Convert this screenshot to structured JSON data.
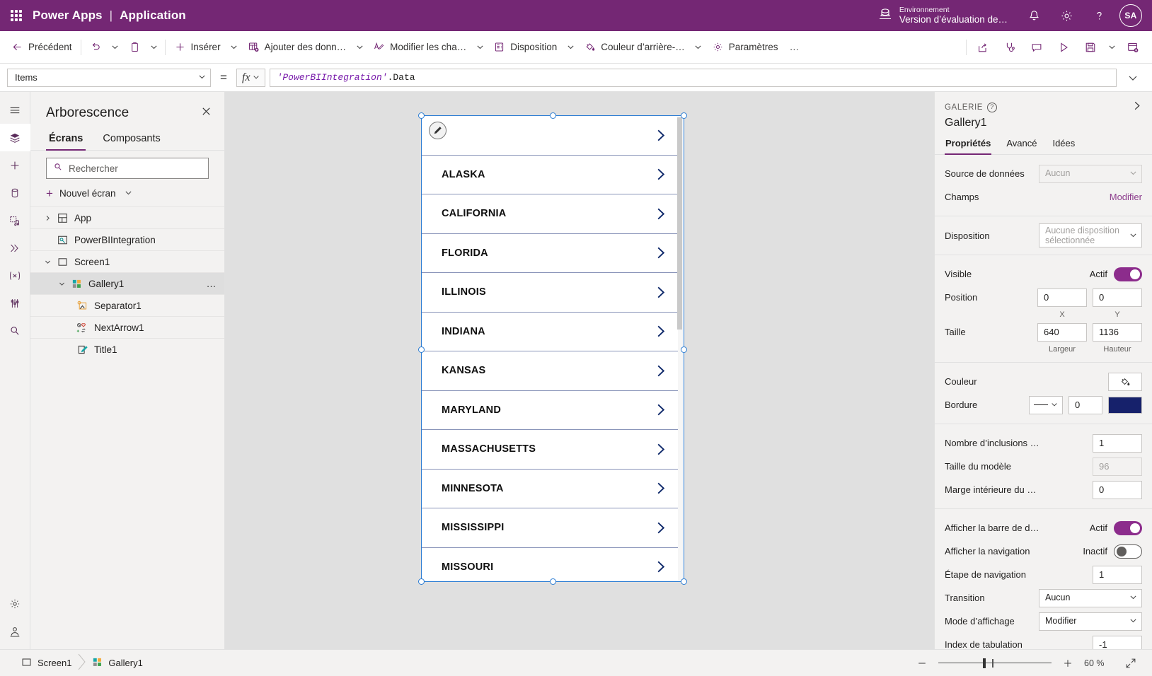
{
  "header": {
    "waffle_icon": "waffle-icon",
    "product": "Power Apps",
    "separator": "|",
    "app_name": "Application",
    "environment_label": "Environnement",
    "environment_value": "Version d’évaluation de…",
    "globe_icon": "environment-globe-icon",
    "bell_icon": "notifications-bell-icon",
    "gear_icon": "settings-gear-icon",
    "help_icon": "help-question-icon",
    "avatar_initials": "SA",
    "brand_color": "#742774"
  },
  "commandbar": {
    "back": "Précédent",
    "undo_icon": "undo-icon",
    "paste_icon": "paste-clipboard-icon",
    "insert": "Insérer",
    "add_data": "Ajouter des donn…",
    "edit_fields": "Modifier les cha…",
    "layout": "Disposition",
    "background_color": "Couleur d’arrière-…",
    "settings": "Paramètres",
    "overflow": "…",
    "right_icons": [
      "share-icon",
      "app-checker-icon",
      "comments-icon",
      "preview-play-icon",
      "save-icon",
      "save-chevron-icon",
      "publish-icon"
    ]
  },
  "formulabar": {
    "property": "Items",
    "equals": "=",
    "fx": "fx",
    "formula_quoted": "'PowerBIIntegration'",
    "formula_rest": ".Data"
  },
  "rail": {
    "items": [
      {
        "name": "hamburger-menu-icon"
      },
      {
        "name": "tree-view-layers-icon",
        "active": true
      },
      {
        "name": "insert-plus-icon"
      },
      {
        "name": "data-cylinder-icon"
      },
      {
        "name": "media-icon"
      },
      {
        "name": "power-automate-icon"
      },
      {
        "name": "variables-icon"
      },
      {
        "name": "tools-icon"
      },
      {
        "name": "search-icon"
      }
    ],
    "bottom": [
      {
        "name": "settings-gear-icon"
      },
      {
        "name": "account-icon"
      }
    ]
  },
  "tree": {
    "title": "Arborescence",
    "close_icon": "close-icon",
    "tabs": [
      {
        "label": "Écrans",
        "active": true
      },
      {
        "label": "Composants",
        "active": false
      }
    ],
    "search_placeholder": "Rechercher",
    "search_value": "",
    "search_icon": "search-icon",
    "new_screen": "Nouvel écran",
    "items": [
      {
        "label": "App",
        "icon": "app-icon",
        "indent": 0,
        "chevron": "collapsed",
        "selected": false
      },
      {
        "label": "PowerBIIntegration",
        "icon": "powerbi-integration-icon",
        "indent": 1,
        "chevron": "none",
        "selected": false
      },
      {
        "label": "Screen1",
        "icon": "screen-icon",
        "indent": 0,
        "chevron": "expanded",
        "selected": false
      },
      {
        "label": "Gallery1",
        "icon": "gallery-icon",
        "indent": 1,
        "chevron": "expanded",
        "selected": true,
        "menu": "…"
      },
      {
        "label": "Separator1",
        "icon": "separator-icon",
        "indent": 2,
        "chevron": "none",
        "selected": false
      },
      {
        "label": "NextArrow1",
        "icon": "next-arrow-icon",
        "indent": 2,
        "chevron": "none",
        "selected": false
      },
      {
        "label": "Title1",
        "icon": "title-label-icon",
        "indent": 2,
        "chevron": "none",
        "selected": false
      }
    ]
  },
  "canvas": {
    "edit_badge_icon": "pencil-edit-icon",
    "gallery_rows": [
      {
        "label": ""
      },
      {
        "label": "ALASKA"
      },
      {
        "label": "CALIFORNIA"
      },
      {
        "label": "FLORIDA"
      },
      {
        "label": "ILLINOIS"
      },
      {
        "label": "INDIANA"
      },
      {
        "label": "KANSAS"
      },
      {
        "label": "MARYLAND"
      },
      {
        "label": "MASSACHUSETTS"
      },
      {
        "label": "MINNESOTA"
      },
      {
        "label": "MISSISSIPPI"
      },
      {
        "label": "MISSOURI"
      }
    ],
    "row_arrow_icon": "chevron-right-icon",
    "selection_color": "#2b7cd3"
  },
  "properties": {
    "kicker": "GALERIE",
    "help_icon": "help-question-icon",
    "collapse_icon": "collapse-panel-icon",
    "control_name": "Gallery1",
    "tabs": [
      {
        "label": "Propriétés",
        "active": true
      },
      {
        "label": "Avancé",
        "active": false
      },
      {
        "label": "Idées",
        "active": false
      }
    ],
    "data_source_label": "Source de données",
    "data_source_value": "Aucun",
    "fields_label": "Champs",
    "fields_action": "Modifier",
    "layout_label": "Disposition",
    "layout_value": "Aucune disposition sélectionnée",
    "visible_label": "Visible",
    "visible_state": "Actif",
    "position_label": "Position",
    "position_x": "0",
    "position_y": "0",
    "position_x_sub": "X",
    "position_y_sub": "Y",
    "size_label": "Taille",
    "size_width": "640",
    "size_height": "1136",
    "size_width_sub": "Largeur",
    "size_height_sub": "Hauteur",
    "color_label": "Couleur",
    "color_icon": "fill-bucket-icon",
    "border_label": "Bordure",
    "border_style_icon": "solid-line-icon",
    "border_width": "0",
    "border_color": "#16216b",
    "wrap_count_label": "Nombre d’inclusions …",
    "wrap_count_value": "1",
    "template_size_label": "Taille du modèle",
    "template_size_value": "96",
    "template_padding_label": "Marge intérieure du …",
    "template_padding_value": "0",
    "show_scrollbar_label": "Afficher la barre de d…",
    "show_scrollbar_state": "Actif",
    "show_navigation_label": "Afficher la navigation",
    "show_navigation_state": "Inactif",
    "nav_step_label": "Étape de navigation",
    "nav_step_value": "1",
    "transition_label": "Transition",
    "transition_value": "Aucun",
    "display_mode_label": "Mode d’affichage",
    "display_mode_value": "Modifier",
    "tab_index_label": "Index de tabulation",
    "tab_index_value": "-1",
    "accent_color": "#8c2c8c"
  },
  "statusbar": {
    "screen_crumb": "Screen1",
    "screen_icon": "screen-icon",
    "control_crumb": "Gallery1",
    "control_icon": "gallery-icon",
    "zoom_out_icon": "minus-icon",
    "zoom_in_icon": "plus-icon",
    "zoom_percent": "60",
    "zoom_unit": "%",
    "fit_icon": "fit-screen-icon"
  }
}
